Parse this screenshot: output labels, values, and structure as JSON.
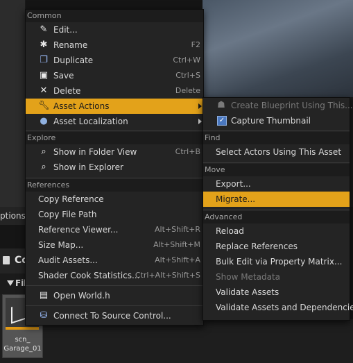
{
  "background": {
    "options_text": "ptions",
    "content_browser_title": "Co",
    "filter_text": "Fil",
    "asset": {
      "label_line1": "scn_",
      "label_line2": "Garage_01"
    }
  },
  "main_menu": {
    "sections": {
      "common": "Common",
      "explore": "Explore",
      "references": "References"
    },
    "items": {
      "edit": {
        "label": "Edit...",
        "icon": "pencil-icon"
      },
      "rename": {
        "label": "Rename",
        "shortcut": "F2",
        "icon": "rename-icon"
      },
      "duplicate": {
        "label": "Duplicate",
        "shortcut": "Ctrl+W",
        "icon": "duplicate-icon"
      },
      "save": {
        "label": "Save",
        "shortcut": "Ctrl+S",
        "icon": "save-icon"
      },
      "delete": {
        "label": "Delete",
        "shortcut": "Delete",
        "icon": "delete-icon"
      },
      "asset_actions": {
        "label": "Asset Actions",
        "icon": "wrench-icon"
      },
      "asset_localization": {
        "label": "Asset Localization",
        "icon": "globe-icon"
      },
      "show_in_folder_view": {
        "label": "Show in Folder View",
        "shortcut": "Ctrl+B",
        "icon": "search-icon"
      },
      "show_in_explorer": {
        "label": "Show in Explorer",
        "icon": "search-icon"
      },
      "copy_reference": {
        "label": "Copy Reference"
      },
      "copy_file_path": {
        "label": "Copy File Path"
      },
      "reference_viewer": {
        "label": "Reference Viewer...",
        "shortcut": "Alt+Shift+R"
      },
      "size_map": {
        "label": "Size Map...",
        "shortcut": "Alt+Shift+M"
      },
      "audit_assets": {
        "label": "Audit Assets...",
        "shortcut": "Alt+Shift+A"
      },
      "shader_cook_statistics": {
        "label": "Shader Cook Statistics...",
        "shortcut": "Ctrl+Alt+Shift+S"
      },
      "open_world": {
        "label": "Open World.h",
        "icon": "file-icon"
      },
      "connect_source_control": {
        "label": "Connect To Source Control...",
        "icon": "source-control-icon"
      }
    }
  },
  "sub_menu": {
    "sections": {
      "find": "Find",
      "move": "Move",
      "advanced": "Advanced"
    },
    "items": {
      "create_blueprint": {
        "label": "Create Blueprint Using This...",
        "disabled": true,
        "icon": "blueprint-icon"
      },
      "capture_thumbnail": {
        "label": "Capture Thumbnail",
        "icon": "checkbox-icon"
      },
      "select_actors": {
        "label": "Select Actors Using This Asset"
      },
      "export": {
        "label": "Export..."
      },
      "migrate": {
        "label": "Migrate..."
      },
      "reload": {
        "label": "Reload"
      },
      "replace_references": {
        "label": "Replace References"
      },
      "bulk_edit": {
        "label": "Bulk Edit via Property Matrix..."
      },
      "show_metadata": {
        "label": "Show Metadata",
        "disabled": true
      },
      "validate_assets": {
        "label": "Validate Assets"
      },
      "validate_assets_deps": {
        "label": "Validate Assets and Dependencies"
      }
    }
  },
  "colors": {
    "highlight": "#e3a21a",
    "menu_bg": "#242424",
    "section_bg": "#1c1c1c"
  }
}
